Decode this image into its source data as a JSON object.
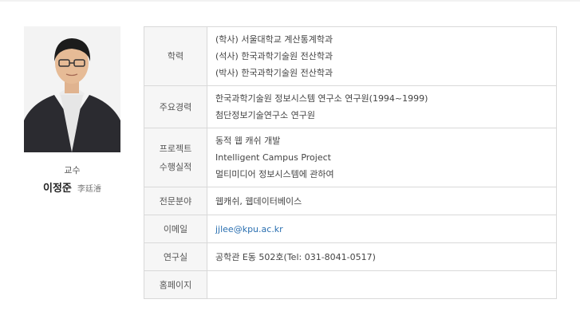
{
  "profile": {
    "photo_icon": "professor-photo",
    "role": "교수",
    "name": "이정준",
    "hanja": "李廷濬"
  },
  "table": {
    "education": {
      "label": "학력",
      "lines": [
        "(학사) 서울대학교 계산통계학과",
        "(석사) 한국과학기술원 전산학과",
        "(박사) 한국과학기술원 전산학과"
      ]
    },
    "career": {
      "label": "주요경력",
      "lines": [
        "한국과학기술원 정보시스템 연구소 연구원(1994~1999)",
        "첨단정보기술연구소 연구원"
      ]
    },
    "projects": {
      "label_line1": "프로젝트",
      "label_line2": "수행실적",
      "lines": [
        "동적 웹 캐쉬 개발",
        "Intelligent Campus Project",
        "멀티미디어 정보시스템에 관하여"
      ]
    },
    "field": {
      "label": "전문분야",
      "value": "웹캐쉬, 웹데이터베이스"
    },
    "email": {
      "label": "이메일",
      "value": "jjlee@kpu.ac.kr"
    },
    "lab": {
      "label": "연구실",
      "value": "공학관 E동 502호(Tel: 031-8041-0517)"
    },
    "homepage": {
      "label": "홈페이지",
      "value": ""
    }
  },
  "colors": {
    "label_bg": "#f6f6f6",
    "border": "#d9d9d9",
    "link": "#2a6fb0"
  }
}
